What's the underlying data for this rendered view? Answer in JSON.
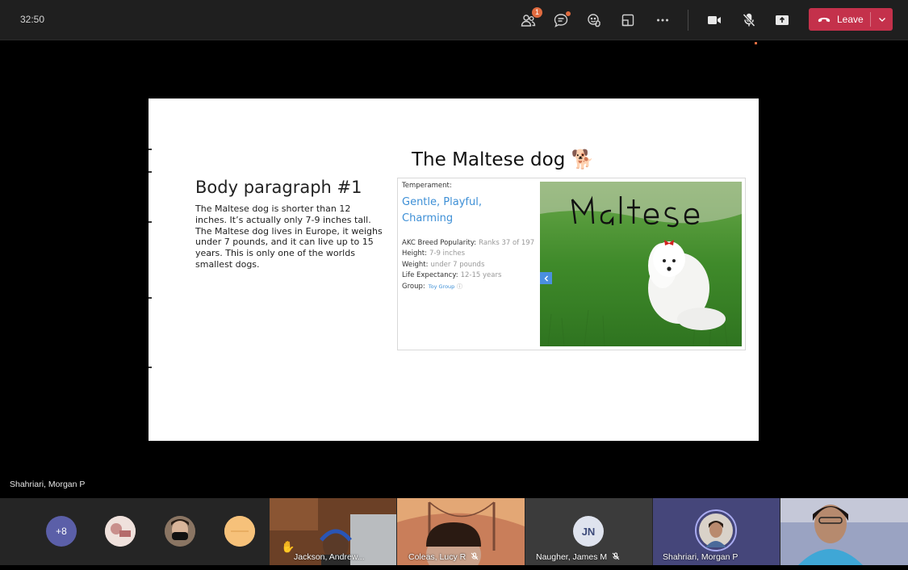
{
  "meeting": {
    "timer": "32:50"
  },
  "toolbar": {
    "participants_badge": "1",
    "leave_label": "Leave"
  },
  "slide": {
    "title": "The Maltese dog 🐕",
    "body_heading": "Body paragraph #1",
    "body_text": "The Maltese dog is shorter than 12 inches. It’s actually only 7-9 inches tall. The Maltese dog lives in Europe, it weighs under 7 pounds, and it can live up to 15 years. This is only one of the worlds smallest dogs.",
    "card": {
      "temperament_label": "Temperament:",
      "temperament_value": "Gentle, Playful, Charming",
      "facts": [
        {
          "label": "AKC Breed Popularity:",
          "value": "Ranks 37 of 197"
        },
        {
          "label": "Height:",
          "value": "7-9 inches"
        },
        {
          "label": "Weight:",
          "value": "under 7 pounds"
        },
        {
          "label": "Life Expectancy:",
          "value": "12-15 years"
        },
        {
          "label": "Group:",
          "value": "Toy Group"
        }
      ],
      "photo_caption": "Maltese"
    }
  },
  "presenter_name": "Shahriari, Morgan P",
  "participants": {
    "overflow_count": "+8",
    "tiles": [
      {
        "name": "Jackson, Andrew..."
      },
      {
        "name": "Coleas, Lucy R"
      },
      {
        "name": "Naugher, James M",
        "initials": "JN"
      },
      {
        "name": "Shahriari, Morgan P"
      }
    ]
  },
  "colors": {
    "leave": "#c4314b",
    "accent": "#5b5fa8",
    "link": "#3d8fd6"
  }
}
